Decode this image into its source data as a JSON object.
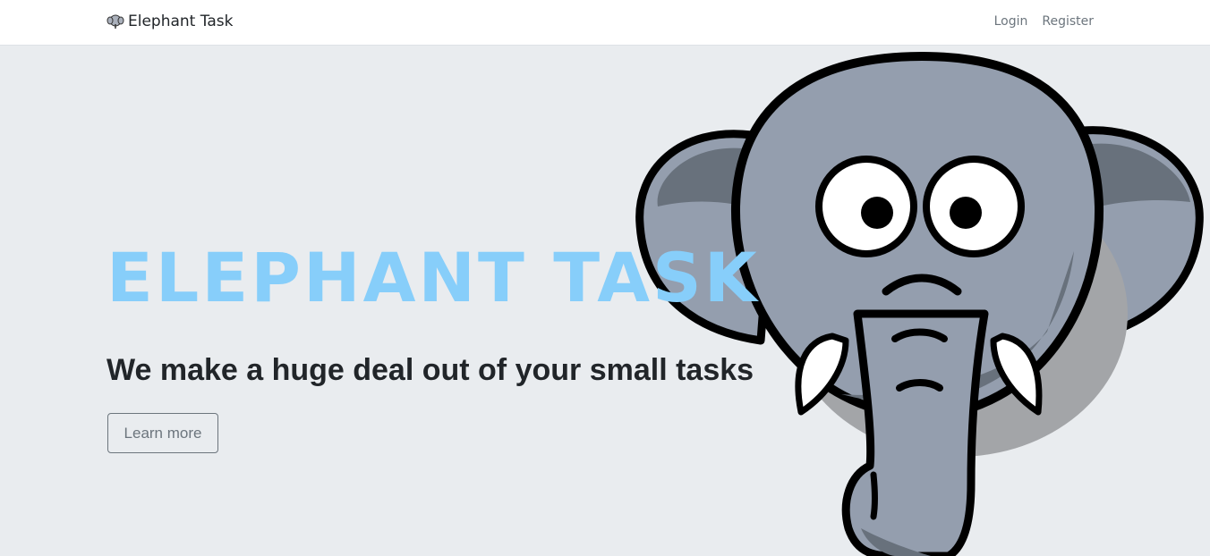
{
  "navbar": {
    "brand_icon": "elephant-icon",
    "brand_label": "Elephant Task",
    "links": [
      {
        "label": "Login"
      },
      {
        "label": "Register"
      }
    ]
  },
  "hero": {
    "title": "ELEPHANT TASK",
    "subtitle": "We make a huge deal out of your small tasks",
    "button_label": "Learn more",
    "illustration": "elephant-illustration"
  },
  "colors": {
    "title": "#87cefa",
    "hero_background": "#e9ecef",
    "elephant_body": "#949eae"
  }
}
